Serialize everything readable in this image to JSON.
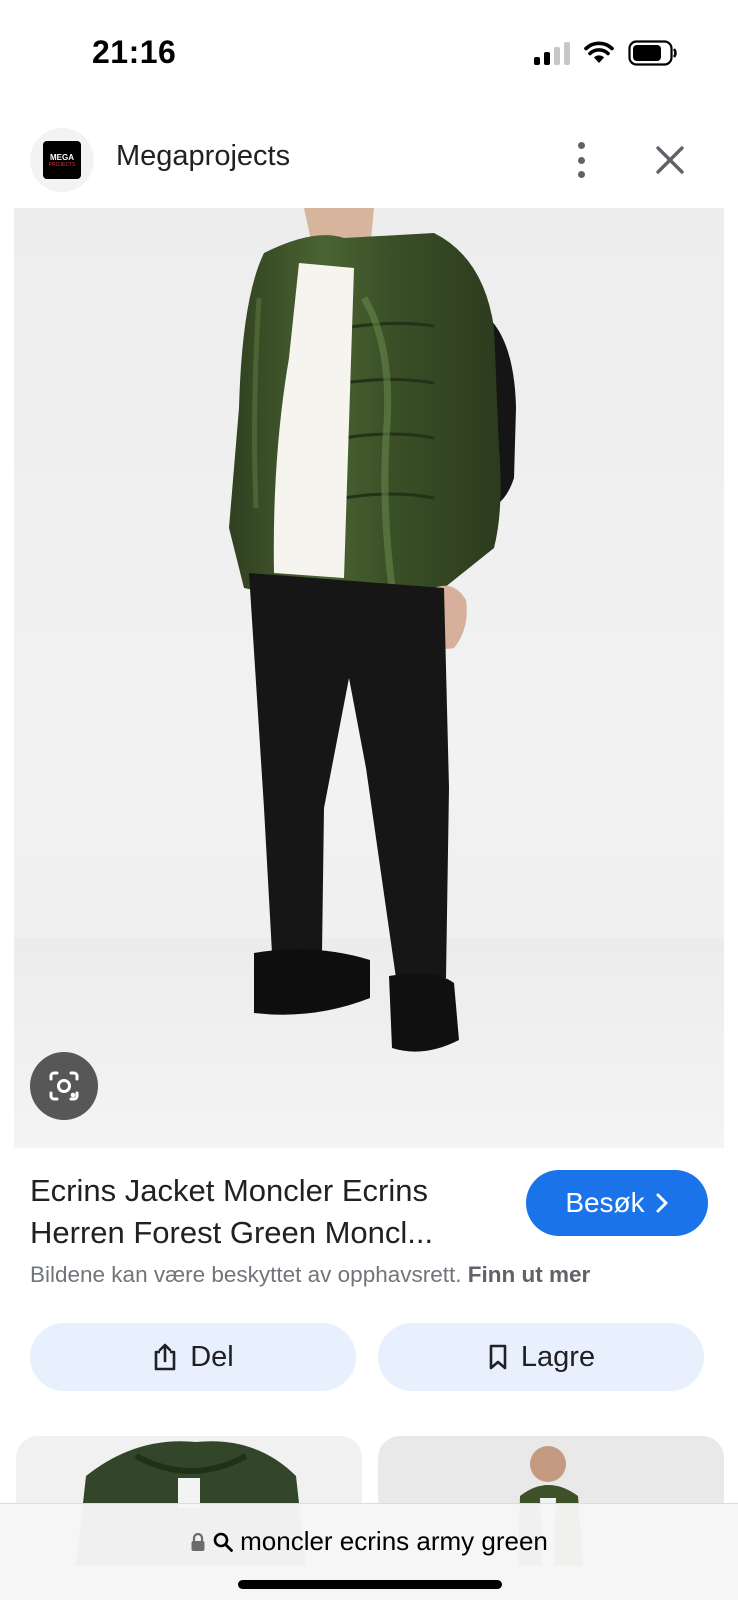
{
  "status_bar": {
    "time": "21:16",
    "icons": [
      "signal-icon",
      "wifi-icon",
      "battery-icon"
    ]
  },
  "header": {
    "avatar_text": "MEGA",
    "avatar_subtext": "PROJECTS",
    "site_name": "Megaprojects",
    "icons": [
      "more-vert-icon",
      "close-icon"
    ]
  },
  "hero": {
    "lens_icon": "lens-search-icon"
  },
  "result": {
    "title_line1": "Ecrins Jacket Moncler Ecrins",
    "title_line2": "Herren Forest Green Moncl...",
    "visit_label": "Besøk",
    "copyright_text": "Bildene kan være beskyttet av opphavsrett.",
    "copyright_link": "Finn ut mer"
  },
  "actions": {
    "share_label": "Del",
    "save_label": "Lagre"
  },
  "url_bar": {
    "query": "moncler ecrins army green"
  },
  "colors": {
    "accent_blue": "#1a73e8",
    "button_tint": "#e8f0fe",
    "jacket_green": "#3f5429"
  }
}
